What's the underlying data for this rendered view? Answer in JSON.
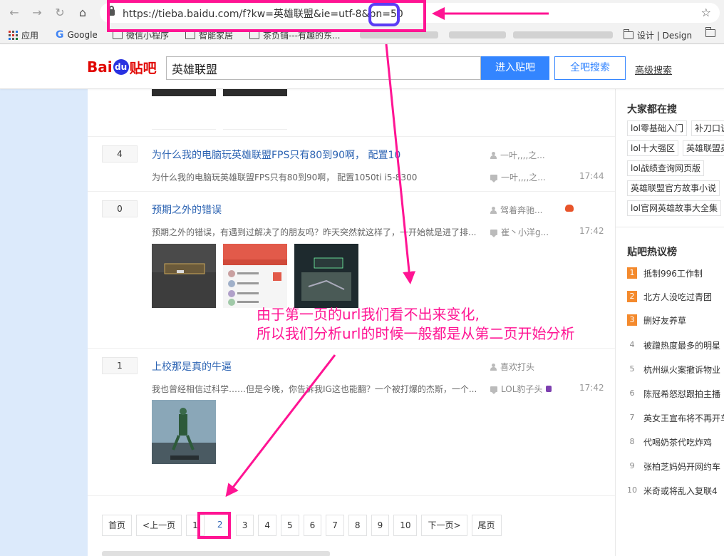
{
  "browser": {
    "url": "https://tieba.baidu.com/f?kw=英雄联盟&ie=utf-8&pn=50",
    "bookmarks": [
      {
        "label": "应用",
        "icon": "apps-icon"
      },
      {
        "label": "Google",
        "icon": "google-icon"
      },
      {
        "label": "微信小程序",
        "icon": "folder-icon"
      },
      {
        "label": "智能家居",
        "icon": "folder-icon"
      },
      {
        "label": "茶负铺---有趣的东...",
        "icon": "folder-icon"
      },
      {
        "label": "设计 | Design",
        "icon": "folder-icon"
      }
    ]
  },
  "tieba": {
    "logo": {
      "bai": "Bai",
      "du": "du",
      "tieba": "贴吧"
    },
    "search_value": "英雄联盟",
    "enter_label": "进入贴吧",
    "all_search_label": "全吧搜索",
    "advanced_label": "高级搜索"
  },
  "threads": [
    {
      "replies": "4",
      "title": "为什么我的电脑玩英雄联盟FPS只有80到90啊， 配置10",
      "abstract": "为什么我的电脑玩英雄联盟FPS只有80到90啊， 配置1050ti i5-8300",
      "author": "一叶,,,,之...",
      "last_reply": "一叶,,,,之...",
      "time": "17:44"
    },
    {
      "replies": "0",
      "title": "预期之外的错误",
      "abstract": "预期之外的错误，有遇到过解决了的朋友吗？昨天突然就这样了，一开始就是进了排...",
      "author": "驾着奔驰...",
      "last_reply": "崔丶小洋g...",
      "time": "17:42"
    },
    {
      "replies": "1",
      "title": "上校那是真的牛逼",
      "abstract": "我也曾经相信过科学……但是今晚，你告诉我IG这也能翻？一个被打爆的杰斯，一个...",
      "author": "喜欢打头",
      "last_reply": "LOL豹子头",
      "time": "17:42"
    }
  ],
  "pagination": [
    "首页",
    "<上一页",
    "1",
    "2",
    "3",
    "4",
    "5",
    "6",
    "7",
    "8",
    "9",
    "10",
    "下一页>",
    "尾页"
  ],
  "pagination_current": "2",
  "sidebar": {
    "search_title": "大家都在搜",
    "tags": [
      "lol零基础入门",
      "补刀口诀",
      "lol十大强区",
      "英雄联盟英",
      "lol战绩查询网页版",
      "英雄联盟官方故事小说",
      "lol官网英雄故事大全集"
    ],
    "hot_title": "贴吧热议榜",
    "hot": [
      {
        "rank": "1",
        "text": "抵制996工作制"
      },
      {
        "rank": "2",
        "text": "北方人没吃过青团"
      },
      {
        "rank": "3",
        "text": "删好友养草"
      },
      {
        "rank": "4",
        "text": "被蹭热度最多的明星"
      },
      {
        "rank": "5",
        "text": "杭州纵火案撤诉物业"
      },
      {
        "rank": "6",
        "text": "陈冠希怒怼跟拍主播"
      },
      {
        "rank": "7",
        "text": "英女王宣布将不再开车"
      },
      {
        "rank": "8",
        "text": "代喝奶茶代吃炸鸡"
      },
      {
        "rank": "9",
        "text": "张柏芝妈妈开网约车"
      },
      {
        "rank": "10",
        "text": "米奇或将乱入复联4"
      }
    ]
  },
  "annotation": {
    "line1": "由于第一页的url我们看不出来变化,",
    "line2": "所以我们分析url的时候一般都是从第二页开始分析",
    "color": "#ff1493",
    "circle_color": "#5b3cf5"
  }
}
